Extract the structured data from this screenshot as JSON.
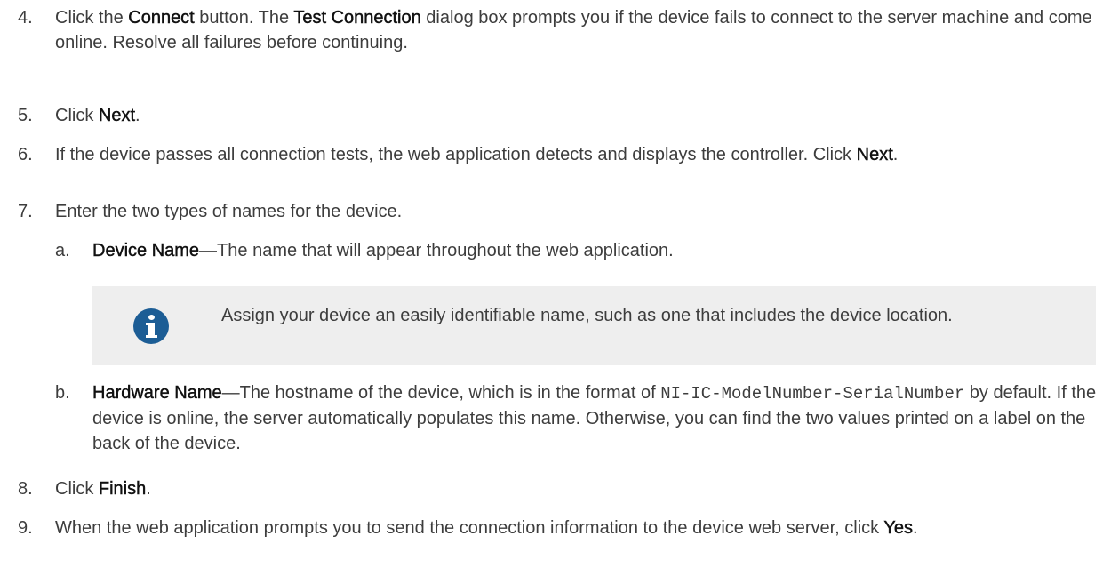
{
  "steps": [
    {
      "num": "4.",
      "parts": [
        {
          "t": "Click the "
        },
        {
          "t": "Connect",
          "b": true
        },
        {
          "t": " button. The "
        },
        {
          "t": "Test Connection",
          "b": true
        },
        {
          "t": " dialog box prompts you if the device fails to connect to the server machine and come online. Resolve all failures before continuing."
        }
      ]
    },
    {
      "num": "5.",
      "parts": [
        {
          "t": "Click "
        },
        {
          "t": "Next",
          "b": true
        },
        {
          "t": "."
        }
      ]
    },
    {
      "num": "6.",
      "parts": [
        {
          "t": "If the device passes all connection tests, the web application detects and displays the controller. Click "
        },
        {
          "t": "Next",
          "b": true
        },
        {
          "t": "."
        }
      ]
    },
    {
      "num": "7.",
      "parts": [
        {
          "t": "Enter the two types of names for the device."
        }
      ]
    },
    {
      "num": "a.",
      "parts": [
        {
          "t": "Device Name",
          "b": true
        },
        {
          "t": "—The name that will appear throughout the web application."
        }
      ]
    },
    {
      "num": "b.",
      "parts": [
        {
          "t": "Hardware Name",
          "b": true
        },
        {
          "t": "—The hostname of the device, which is in the format of "
        },
        {
          "t": "NI-IC-ModelNumber-SerialNumber",
          "code": true
        },
        {
          "t": " by default. If the device is online, the server automatically populates this name. Otherwise, you can find the two values printed on a label on the back of the device."
        }
      ]
    },
    {
      "num": "8.",
      "parts": [
        {
          "t": "Click "
        },
        {
          "t": "Finish",
          "b": true
        },
        {
          "t": "."
        }
      ]
    },
    {
      "num": "9.",
      "parts": [
        {
          "t": "When the web application prompts you to send the connection information to the device web server, click "
        },
        {
          "t": "Yes",
          "b": true
        },
        {
          "t": "."
        }
      ]
    }
  ],
  "note": {
    "icon": "info-icon",
    "text": "Assign your device an easily identifiable name, such as one that includes the device location."
  },
  "colors": {
    "text": "#3d3d3d",
    "bold": "#111111",
    "note_bg": "#eeeeee",
    "info_icon": "#1c5d95"
  }
}
